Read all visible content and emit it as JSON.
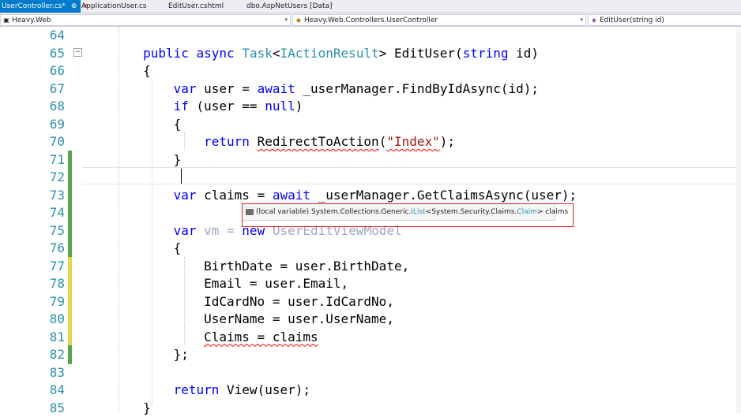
{
  "tabs": [
    {
      "label": "UserController.cs*",
      "active": true,
      "pin": "⊕",
      "close": "×"
    },
    {
      "label": "ApplicationUser.cs",
      "active": false
    },
    {
      "label": "EditUser.cshtml",
      "active": false
    },
    {
      "label": "dbo.AspNetUsers [Data]",
      "active": false
    }
  ],
  "navbar": {
    "project": "Heavy.Web",
    "type": "Heavy.Web.Controllers.UserController",
    "member": "EditUser(string id)"
  },
  "editor": {
    "line_numbers": [
      "64",
      "65",
      "66",
      "67",
      "68",
      "69",
      "70",
      "71",
      "72",
      "73",
      "74",
      "75",
      "76",
      "77",
      "78",
      "79",
      "80",
      "81",
      "82",
      "83",
      "84",
      "85"
    ],
    "lines": {
      "l65": {
        "kw1": "public",
        "kw2": "async",
        "ty1": "Task",
        "p1": "<",
        "ty2": "IActionResult",
        "p2": "> EditUser(",
        "kw3": "string",
        "p3": " id)"
      },
      "l66": "{",
      "l67": {
        "kw1": "var",
        "p1": " user = ",
        "kw2": "await",
        "p2": " _userManager.FindByIdAsync(id);"
      },
      "l68": {
        "kw1": "if",
        "p1": " (user == ",
        "kw2": "null",
        "p2": ")"
      },
      "l69": "{",
      "l70": {
        "kw1": "return",
        "fn": "RedirectToAction",
        "p1": "(",
        "st": "\"Index\"",
        "p2": ");"
      },
      "l71": "}",
      "l73": {
        "kw1": "var",
        "p1": " claims = ",
        "kw2": "await",
        "p2": " _userManager.GetClaimsAsync(user);"
      },
      "l75": {
        "kw1": "var",
        "p1": " vm = ",
        "kw2": "new",
        "ty": "UserEditViewModel"
      },
      "l76": "{",
      "l77": "BirthDate = user.BirthDate,",
      "l78": "Email = user.Email,",
      "l79": "IdCardNo = user.IdCardNo,",
      "l80": "UserName = user.UserName,",
      "l81": "Claims = claims",
      "l82": "};",
      "l84": {
        "kw1": "return",
        "fn": "View",
        "p1": "(user);"
      },
      "l85": "}"
    }
  },
  "tooltip": {
    "icon": "local-variable-icon",
    "prefix": "(local variable) System.Collections.Generic.",
    "iface": "IList",
    "mid": "<System.Security.Claims.",
    "claim": "Claim",
    "suffix": "> claims"
  },
  "colors": {
    "keyword": "#0000ff",
    "type": "#2b91af",
    "string": "#a31515",
    "linenumber": "#2b91af",
    "change_saved": "#57a64a",
    "change_unsaved": "#e8d44d",
    "active_tab": "#007acc",
    "highlight_box": "#e02424"
  }
}
